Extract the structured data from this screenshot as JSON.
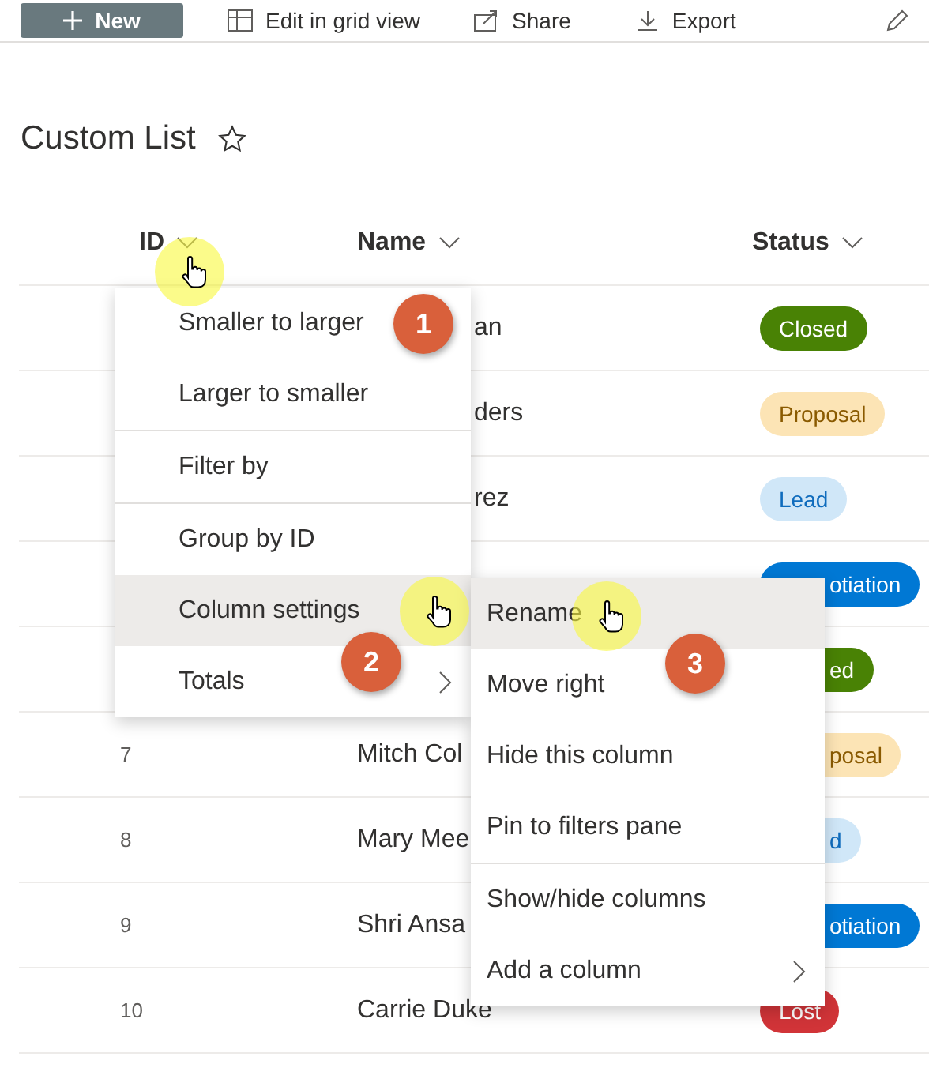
{
  "toolbar": [
    {
      "label": "New",
      "kind": "new"
    },
    {
      "label": "Edit in grid view",
      "kind": "grid"
    },
    {
      "label": "Share",
      "kind": "share"
    },
    {
      "label": "Export",
      "kind": "export"
    },
    {
      "kind": "edit"
    }
  ],
  "title": "Custom List",
  "favorite": false,
  "table": {
    "columns": [
      {
        "label": "ID"
      },
      {
        "label": "Name"
      },
      {
        "label": "Status"
      }
    ],
    "rows": [
      {
        "name": "an",
        "status": {
          "label": "Closed",
          "kind": "closed"
        }
      },
      {
        "name": "ders",
        "status": {
          "label": "Proposal",
          "kind": "proposal"
        }
      },
      {
        "name": "rez",
        "status": {
          "label": "Lead",
          "kind": "lead"
        }
      },
      {
        "status": {
          "label": "otiation",
          "kind": "negotiation"
        }
      },
      {
        "status": {
          "label": "ed",
          "kind": "closed"
        }
      },
      {
        "id": "7",
        "name": "Mitch Col",
        "status": {
          "label": "posal",
          "kind": "proposal"
        }
      },
      {
        "id": "8",
        "name": "Mary Mee",
        "status": {
          "label": "d",
          "kind": "lead"
        }
      },
      {
        "id": "9",
        "name": "Shri Ansa",
        "status": {
          "label": "otiation",
          "kind": "negotiation"
        }
      },
      {
        "id": "10",
        "name": "Carrie Duke",
        "status": {
          "label": "Lost",
          "kind": "lost"
        }
      }
    ]
  },
  "column_menu": {
    "items": [
      {
        "kind": "item",
        "label": "Smaller to larger",
        "selected": false
      },
      {
        "kind": "item",
        "label": "Larger to smaller",
        "selected": false
      },
      {
        "kind": "divider"
      },
      {
        "kind": "item",
        "label": "Filter by",
        "selected": false
      },
      {
        "kind": "divider"
      },
      {
        "kind": "item",
        "label": "Group by ID",
        "selected": false
      },
      {
        "kind": "item",
        "label": "Column settings",
        "selected": true
      },
      {
        "kind": "submenu",
        "label": "Totals",
        "selected": false
      }
    ]
  },
  "settings_submenu": {
    "items": [
      {
        "kind": "item",
        "label": "Rename",
        "selected": true
      },
      {
        "kind": "item",
        "label": "Move right",
        "selected": false
      },
      {
        "kind": "item",
        "label": "Hide this column",
        "selected": false
      },
      {
        "kind": "item",
        "label": "Pin to filters pane",
        "selected": false
      },
      {
        "kind": "divider"
      },
      {
        "kind": "item",
        "label": "Show/hide columns",
        "selected": false
      },
      {
        "kind": "submenu",
        "label": "Add a column",
        "selected": false
      }
    ]
  },
  "steps": [
    {
      "number": "1"
    },
    {
      "number": "2"
    },
    {
      "number": "3"
    }
  ]
}
